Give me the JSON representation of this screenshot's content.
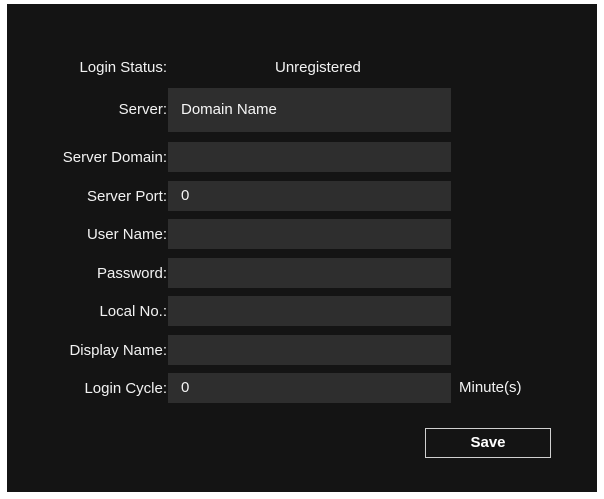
{
  "form": {
    "login_status": {
      "label": "Login Status:",
      "value": "Unregistered"
    },
    "server": {
      "label": "Server:",
      "value": "Domain Name"
    },
    "server_domain": {
      "label": "Server Domain:",
      "value": ""
    },
    "server_port": {
      "label": "Server Port:",
      "value": "0"
    },
    "user_name": {
      "label": "User Name:",
      "value": ""
    },
    "password": {
      "label": "Password:",
      "value": ""
    },
    "local_no": {
      "label": "Local No.:",
      "value": ""
    },
    "display_name": {
      "label": "Display Name:",
      "value": ""
    },
    "login_cycle": {
      "label": "Login Cycle:",
      "value": "0",
      "unit": "Minute(s)"
    }
  },
  "actions": {
    "save_label": "Save"
  },
  "colors": {
    "panel_background": "#141414",
    "field_background": "#2e2e2e",
    "text": "#f2f2f2",
    "button_border": "#d0d0d0"
  }
}
